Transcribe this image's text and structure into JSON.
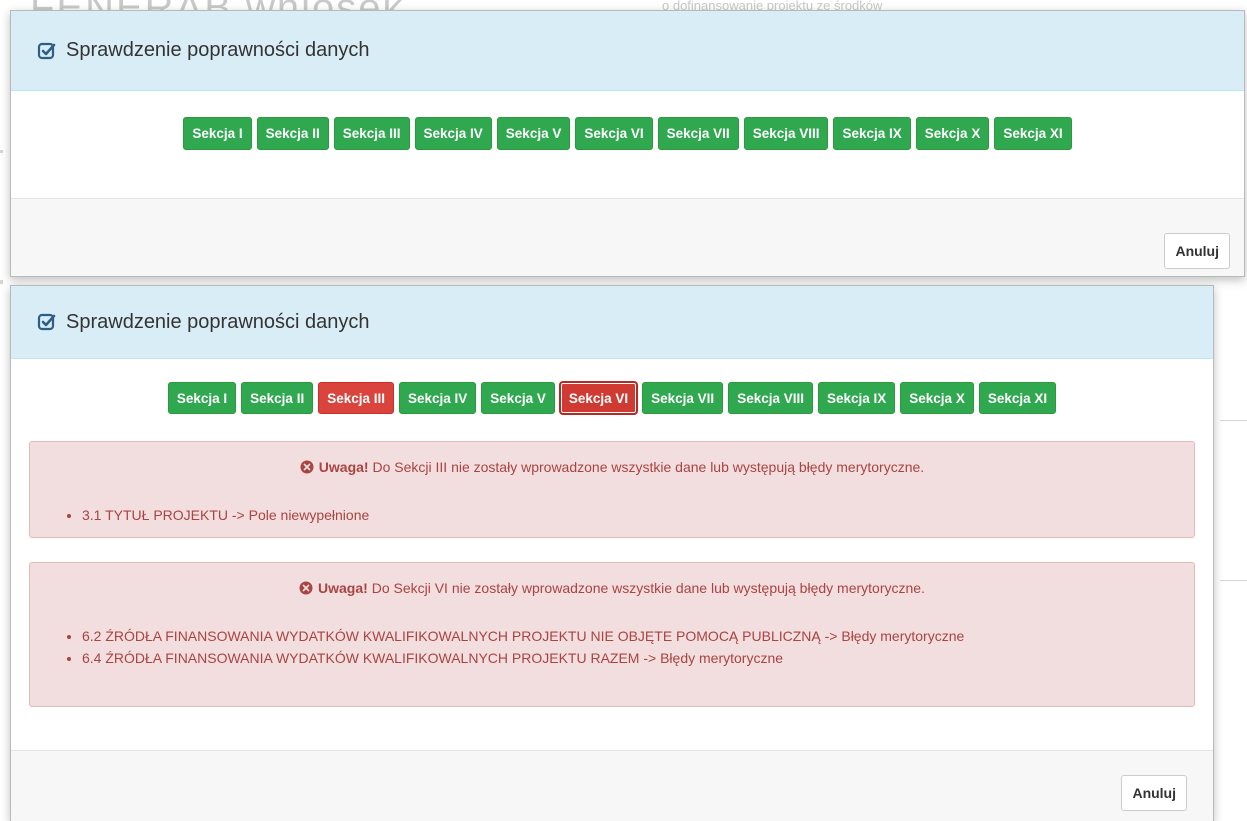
{
  "background": {
    "left_text": "FENERAB wniosek",
    "right_text": "o dofinansowanie projektu ze środków"
  },
  "dialog1": {
    "title": "Sprawdzenie poprawności danych",
    "sections": [
      {
        "label": "Sekcja I",
        "status": "ok"
      },
      {
        "label": "Sekcja II",
        "status": "ok"
      },
      {
        "label": "Sekcja III",
        "status": "ok"
      },
      {
        "label": "Sekcja IV",
        "status": "ok"
      },
      {
        "label": "Sekcja V",
        "status": "ok"
      },
      {
        "label": "Sekcja VI",
        "status": "ok"
      },
      {
        "label": "Sekcja VII",
        "status": "ok"
      },
      {
        "label": "Sekcja VIII",
        "status": "ok"
      },
      {
        "label": "Sekcja IX",
        "status": "ok"
      },
      {
        "label": "Sekcja X",
        "status": "ok"
      },
      {
        "label": "Sekcja XI",
        "status": "ok"
      }
    ],
    "cancel_label": "Anuluj"
  },
  "dialog2": {
    "title": "Sprawdzenie poprawności danych",
    "sections": [
      {
        "label": "Sekcja I",
        "status": "ok"
      },
      {
        "label": "Sekcja II",
        "status": "ok"
      },
      {
        "label": "Sekcja III",
        "status": "error"
      },
      {
        "label": "Sekcja IV",
        "status": "ok"
      },
      {
        "label": "Sekcja V",
        "status": "ok"
      },
      {
        "label": "Sekcja VI",
        "status": "active-error"
      },
      {
        "label": "Sekcja VII",
        "status": "ok"
      },
      {
        "label": "Sekcja VIII",
        "status": "ok"
      },
      {
        "label": "Sekcja IX",
        "status": "ok"
      },
      {
        "label": "Sekcja X",
        "status": "ok"
      },
      {
        "label": "Sekcja XI",
        "status": "ok"
      }
    ],
    "alerts": [
      {
        "strong": "Uwaga!",
        "message": " Do Sekcji III nie zostały wprowadzone wszystkie dane lub występują błędy merytoryczne.",
        "items": [
          "3.1 TYTUŁ PROJEKTU -> Pole niewypełnione"
        ]
      },
      {
        "strong": "Uwaga!",
        "message": " Do Sekcji VI nie zostały wprowadzone wszystkie dane lub występują błędy merytoryczne.",
        "items": [
          "6.2 ŹRÓDŁA FINANSOWANIA WYDATKÓW KWALIFIKOWALNYCH PROJEKTU NIE OBJĘTE POMOCĄ PUBLICZNĄ -> Błędy merytoryczne",
          "6.4 ŹRÓDŁA FINANSOWANIA WYDATKÓW KWALIFIKOWALNYCH PROJEKTU RAZEM -> Błędy merytoryczne"
        ]
      }
    ],
    "cancel_label": "Anuluj"
  },
  "colors": {
    "success": "#2fa84f",
    "danger": "#d9453d",
    "header_bg": "#d9edf7",
    "alert_bg": "#f2dede",
    "alert_text": "#a94442"
  },
  "icons": {
    "title_icon": "check-square-icon",
    "alert_icon": "times-circle-icon"
  }
}
